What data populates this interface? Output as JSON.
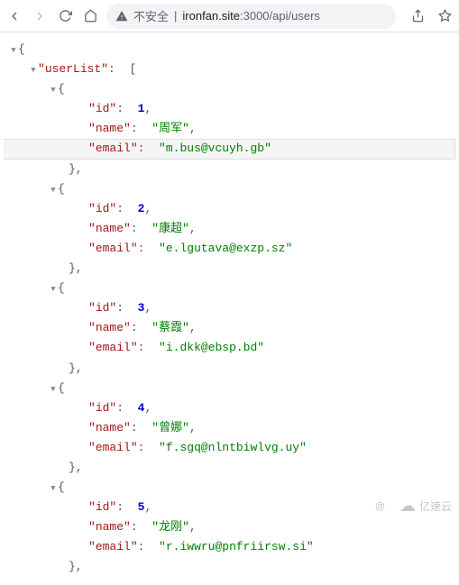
{
  "toolbar": {
    "insecure_label": "不安全",
    "url_host": "ironfan.site",
    "url_port": ":3000",
    "url_path": "/api/users"
  },
  "json": {
    "root_key": "userList",
    "id_key": "id",
    "name_key": "name",
    "email_key": "email",
    "users": [
      {
        "id": 1,
        "name": "周军",
        "email": "m.bus@vcuyh.gb"
      },
      {
        "id": 2,
        "name": "康超",
        "email": "e.lgutava@exzp.sz"
      },
      {
        "id": 3,
        "name": "蔡霞",
        "email": "i.dkk@ebsp.bd"
      },
      {
        "id": 4,
        "name": "曾娜",
        "email": "f.sgq@nlntbiwlvg.uy"
      },
      {
        "id": 5,
        "name": "龙刚",
        "email": "r.iwwru@pnfriirsw.si"
      }
    ]
  },
  "watermark": {
    "at": "@",
    "text": "亿速云"
  }
}
